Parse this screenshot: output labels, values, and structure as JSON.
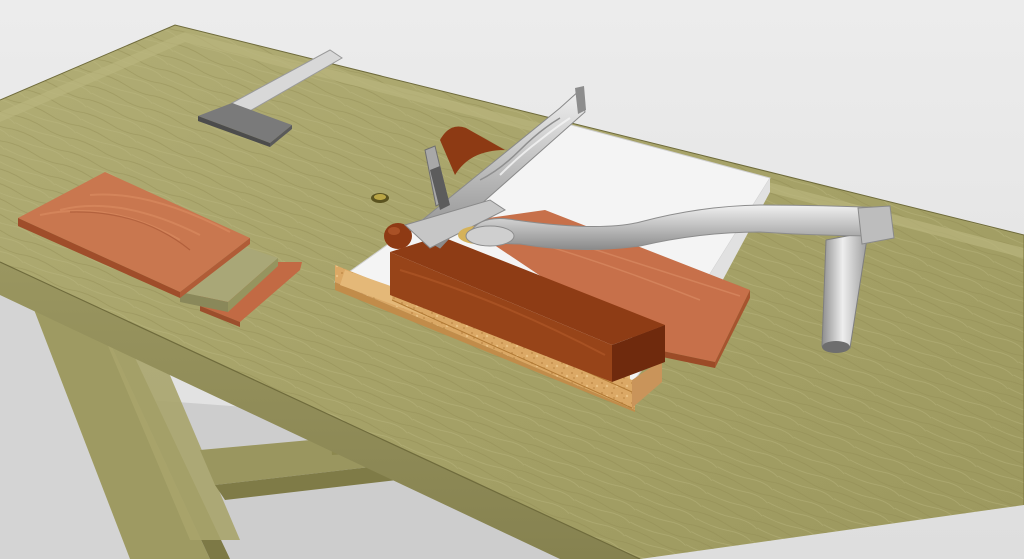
{
  "scene": {
    "title": "",
    "colors": {
      "background_wall": "#e6e6e6",
      "floor": "#d2d2d2",
      "bench_wood": "#a6a468",
      "bench_wood_dark": "#8a874f",
      "mahogany": "#c56f49",
      "dark_wood": "#8f3d16",
      "particle_board": "#dba865",
      "white_board": "#f4f4f4",
      "steel": "#c9c9c9",
      "steel_dark": "#8d8d8d"
    },
    "objects": [
      "workbench",
      "try-square",
      "stacked-boards",
      "bench-hook-jig",
      "plane",
      "holdfast"
    ]
  }
}
